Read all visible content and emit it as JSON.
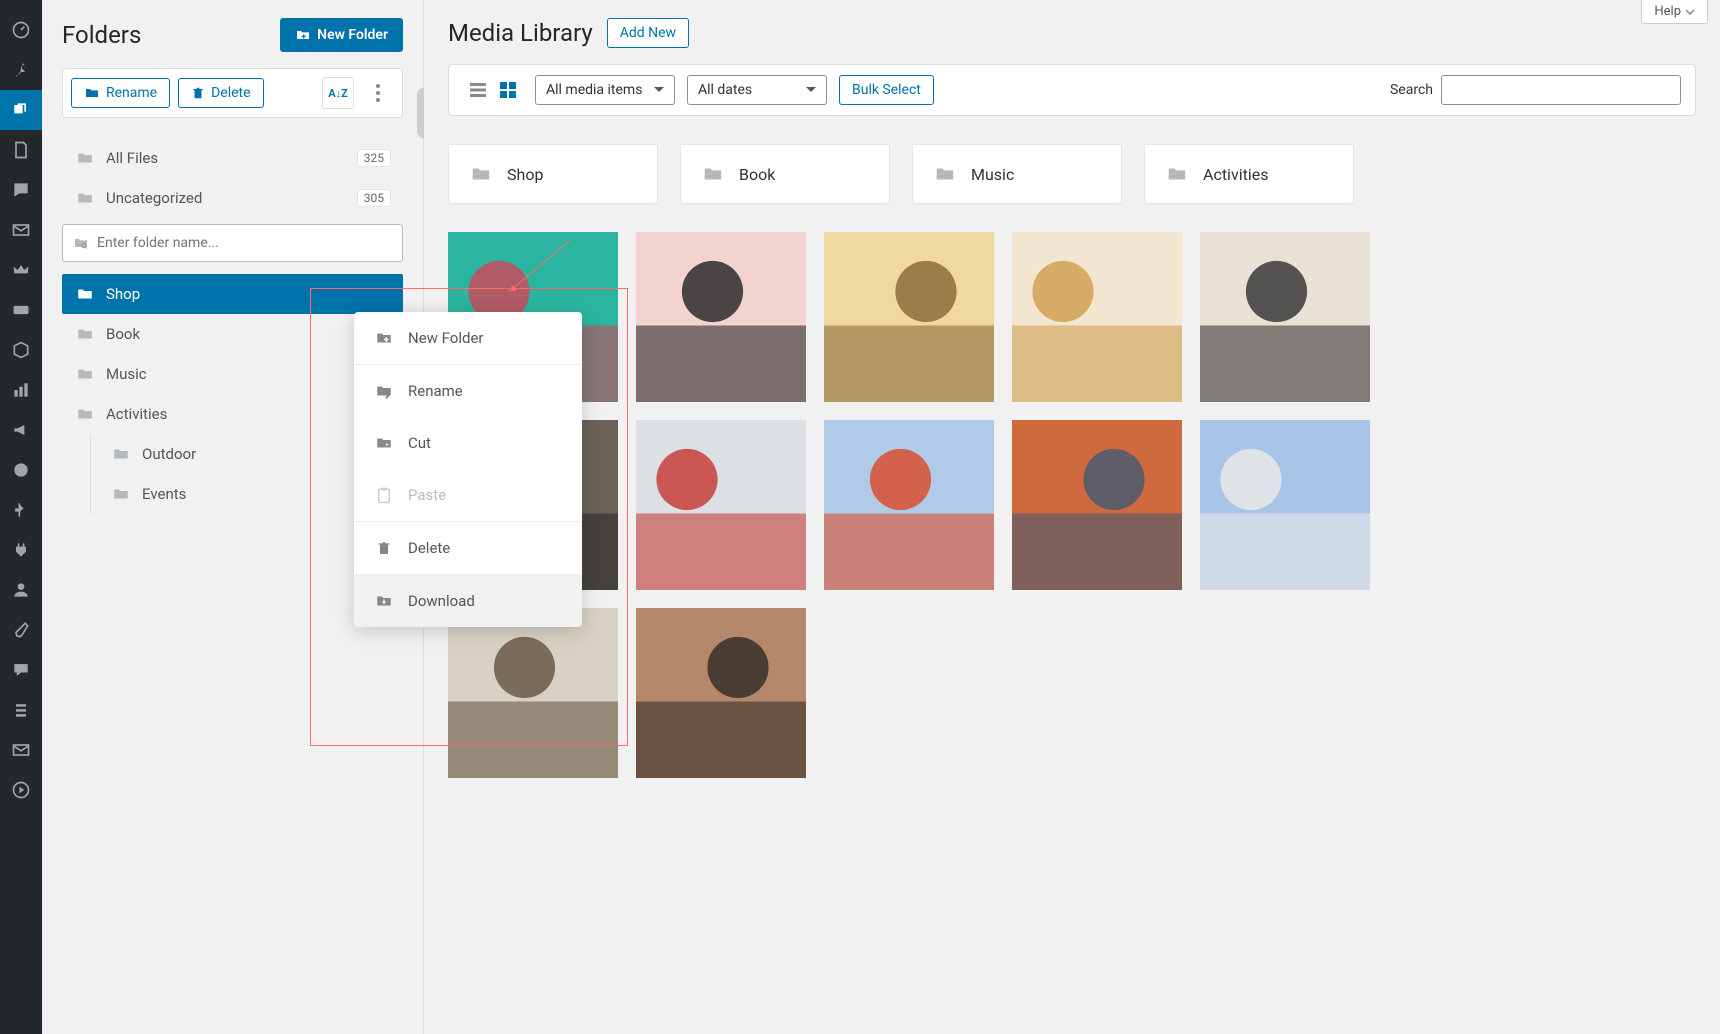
{
  "help_label": "Help",
  "folders_panel": {
    "title": "Folders",
    "new_folder_btn": "New Folder",
    "rename_btn": "Rename",
    "delete_btn": "Delete",
    "sort_label": "A↓Z",
    "search_placeholder": "Enter folder name...",
    "all_files": {
      "label": "All Files",
      "count": "325"
    },
    "uncategorized": {
      "label": "Uncategorized",
      "count": "305"
    },
    "tree": [
      {
        "label": "Shop",
        "active": true
      },
      {
        "label": "Book"
      },
      {
        "label": "Music"
      },
      {
        "label": "Activities"
      },
      {
        "label": "Outdoor",
        "child": true
      },
      {
        "label": "Events",
        "child": true
      }
    ]
  },
  "context_menu": {
    "items": [
      {
        "label": "New Folder",
        "icon": "folder-plus"
      },
      {
        "label": "Rename",
        "icon": "rename",
        "divider_before": true
      },
      {
        "label": "Cut",
        "icon": "cut"
      },
      {
        "label": "Paste",
        "icon": "paste",
        "disabled": true
      },
      {
        "label": "Delete",
        "icon": "trash",
        "divider_before": true
      },
      {
        "label": "Download",
        "icon": "download",
        "divider_before": true,
        "hover": true
      }
    ]
  },
  "media": {
    "title": "Media Library",
    "add_new_btn": "Add New",
    "filter_type": "All media items",
    "filter_date": "All dates",
    "bulk_select_btn": "Bulk Select",
    "search_label": "Search",
    "folder_cards": [
      {
        "label": "Shop"
      },
      {
        "label": "Book"
      },
      {
        "label": "Music"
      },
      {
        "label": "Activities"
      }
    ],
    "thumbnails": [
      {
        "c1": "#2bb5a0",
        "c2": "#c84b5a"
      },
      {
        "c1": "#f3d3d0",
        "c2": "#2b2b2b"
      },
      {
        "c1": "#efd9a0",
        "c2": "#8a6d3b"
      },
      {
        "c1": "#f2e6d0",
        "c2": "#d1a054"
      },
      {
        "c1": "#e8e2d6",
        "c2": "#3a3a3a"
      },
      {
        "c1": "#6b6257",
        "c2": "#2b2b2b"
      },
      {
        "c1": "#dcdfe4",
        "c2": "#c7403a"
      },
      {
        "c1": "#b0cbe8",
        "c2": "#d94f2f"
      },
      {
        "c1": "#cf6a3e",
        "c2": "#4a5a70"
      },
      {
        "c1": "#a8c5e8",
        "c2": "#e8e8e8"
      },
      {
        "c1": "#d9d2c4",
        "c2": "#6a5a48"
      },
      {
        "c1": "#b5876b",
        "c2": "#3a3028"
      }
    ]
  }
}
